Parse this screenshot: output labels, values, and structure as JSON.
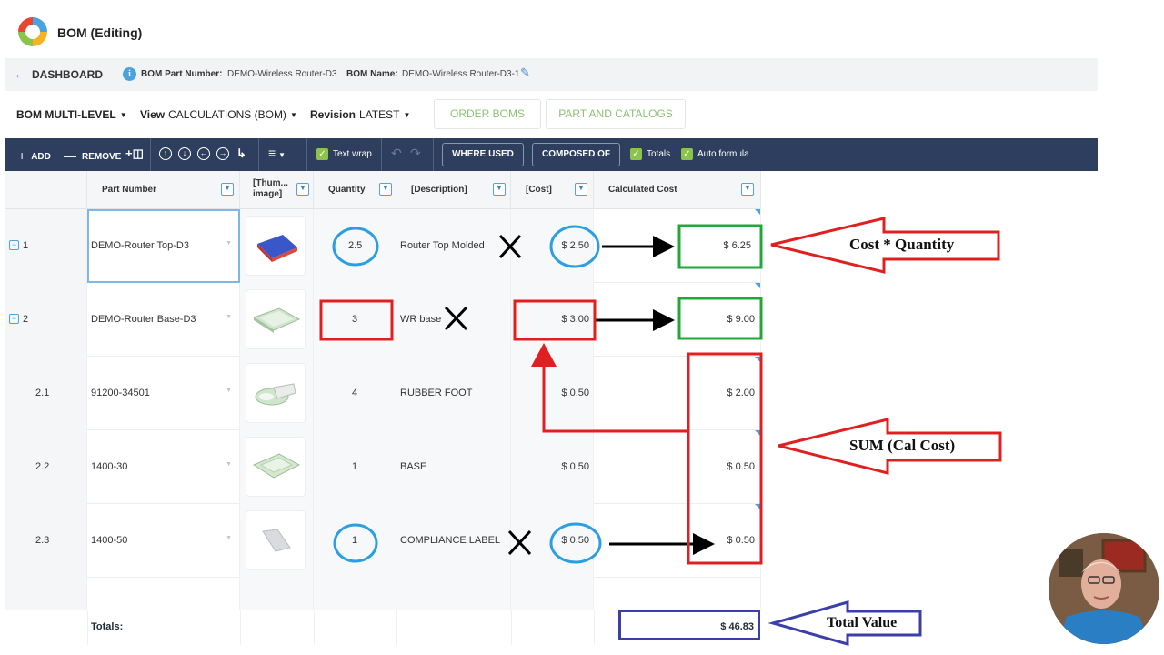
{
  "app": {
    "title": "BOM (Editing)"
  },
  "breadcrumb": {
    "back_label": "DASHBOARD",
    "part_number_key": "BOM Part Number:",
    "part_number_value": "DEMO-Wireless Router-D3",
    "bom_name_key": "BOM Name:",
    "bom_name_value": "DEMO-Wireless Router-D3-1"
  },
  "selectors": {
    "bom_level": "BOM MULTI-LEVEL",
    "view_prefix": "View",
    "view_value": "CALCULATIONS (BOM)",
    "revision_prefix": "Revision",
    "revision_value": "LATEST",
    "order_boms": "ORDER BOMS",
    "part_catalogs": "PART AND CATALOGS"
  },
  "toolbar": {
    "add": "ADD",
    "remove": "REMOVE",
    "text_wrap": "Text wrap",
    "where_used": "WHERE USED",
    "composed_of": "COMPOSED OF",
    "totals": "Totals",
    "auto_formula": "Auto formula"
  },
  "columns": {
    "part_number": "Part Number",
    "thumbnail_1": "[Thum...",
    "thumbnail_2": "image]",
    "quantity": "Quantity",
    "description": "[Description]",
    "cost": "[Cost]",
    "calculated_cost": "Calculated Cost"
  },
  "rows": [
    {
      "index": "1",
      "part": "DEMO-Router Top-D3",
      "qty": "2.5",
      "desc": "Router Top Molded",
      "cost": "$ 2.50",
      "calc": "$ 6.25"
    },
    {
      "index": "2",
      "part": "DEMO-Router Base-D3",
      "qty": "3",
      "desc": "WR base",
      "cost": "$ 3.00",
      "calc": "$ 9.00"
    },
    {
      "index": "2.1",
      "part": "91200-34501",
      "qty": "4",
      "desc": "RUBBER FOOT",
      "cost": "$ 0.50",
      "calc": "$ 2.00"
    },
    {
      "index": "2.2",
      "part": "1400-30",
      "qty": "1",
      "desc": "BASE",
      "cost": "$ 0.50",
      "calc": "$ 0.50"
    },
    {
      "index": "2.3",
      "part": "1400-50",
      "qty": "1",
      "desc": "COMPLIANCE LABEL",
      "cost": "$ 0.50",
      "calc": "$ 0.50"
    }
  ],
  "totals": {
    "label": "Totals:",
    "value": "$ 46.83"
  },
  "annotations": {
    "cost_quantity": "Cost * Quantity",
    "sum_cal_cost": "SUM (Cal Cost)",
    "total_value": "Total Value"
  },
  "colors": {
    "toolbar_bg": "#2d3e5e",
    "accent_green": "#8cc34b",
    "accent_blue": "#4aa3df",
    "anno_red": "#e02020",
    "anno_green": "#22a83a",
    "anno_blue": "#3b3fa8",
    "anno_cyan": "#2b9fe0"
  }
}
